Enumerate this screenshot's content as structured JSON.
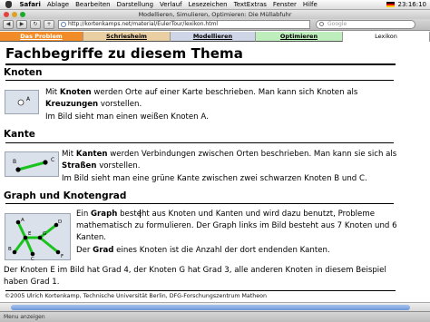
{
  "menubar": {
    "app": "Safari",
    "items": [
      "Ablage",
      "Bearbeiten",
      "Darstellung",
      "Verlauf",
      "Lesezeichen",
      "TextExtras",
      "Fenster",
      "Hilfe"
    ],
    "clock": "23:16:10"
  },
  "window": {
    "title": "Modellieren, Simulieren, Optimieren: Die Müllabfuhr",
    "url": "http://kortenkamps.net/material/EulerTour/lexikon.html",
    "search_placeholder": "Google"
  },
  "sitenav": {
    "tabs": [
      {
        "label": "Das Problem"
      },
      {
        "label": "Schriesheim"
      },
      {
        "label": "Modellieren"
      },
      {
        "label": "Optimieren"
      },
      {
        "label": "Lexikon"
      }
    ]
  },
  "page": {
    "title": "Fachbegriffe zu diesem Thema",
    "sections": {
      "knoten": {
        "heading": "Knoten",
        "p1_a": "Mit ",
        "p1_b": "Knoten",
        "p1_c": " werden Orte auf einer Karte beschrieben. Man kann sich Knoten als",
        "p1_d": "Kreuzungen",
        "p1_e": " vorstellen.",
        "p2": "Im Bild sieht man einen weißen Knoten A.",
        "node_label": "A"
      },
      "kante": {
        "heading": "Kante",
        "p1_a": "Mit ",
        "p1_b": "Kanten",
        "p1_c": " werden Verbindungen zwischen Orten beschrieben. Man kann sie sich als",
        "p1_d": "Straßen",
        "p1_e": " vorstellen.",
        "p2": "Im Bild sieht man eine grüne Kante zwischen zwei schwarzen Knoten B und C.",
        "label_b": "B",
        "label_c": "C"
      },
      "graph": {
        "heading": "Graph und Knotengrad",
        "p1_a": "Ein ",
        "p1_b": "Graph",
        "p1_c": " besteht aus Knoten und Kanten und wird dazu benutzt, Probleme",
        "p1_d": "mathematisch zu formulieren. Der Graph links im Bild besteht aus 7 Knoten und 6",
        "p1_e": "Kanten.",
        "p2_a": "Der ",
        "p2_b": "Grad",
        "p2_c": " eines Knoten ist die Anzahl der dort endenden Kanten.",
        "p3_a": "Der Knoten E im Bild hat Grad 4, der Knoten G hat Grad 3, alle anderen Knoten in diesem Beispiel",
        "p3_b": "haben Grad 1.",
        "labels": {
          "a": "A",
          "b": "B",
          "c": "C",
          "d": "D",
          "e": "E",
          "f": "F",
          "g": "G"
        }
      }
    },
    "footer": "©2005 Ulrich Kortenkamp, Technische Universität Berlin, DFG-Forschungszentrum Matheon"
  },
  "statusbar": {
    "text": "Menu anzeigen"
  },
  "colors": {
    "tab_problem": "#f28c28",
    "tab_schriesheim": "#e9cfa2",
    "tab_modellieren": "#cfd6e8",
    "tab_optimieren": "#bfeebd",
    "edge_green": "#19c21d"
  }
}
